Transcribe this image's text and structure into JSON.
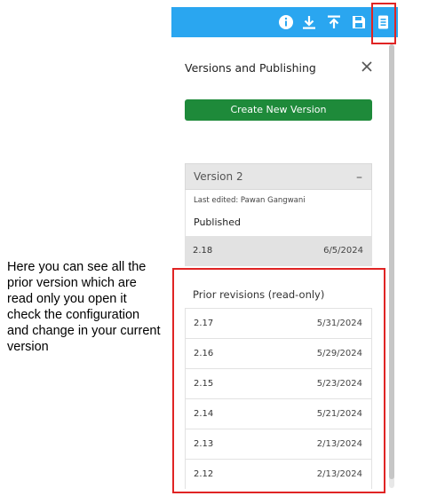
{
  "annotation": {
    "lines": [
      "Here you can see all the",
      "prior version which are",
      "read only you open it",
      "check the configuration",
      "and change in your current",
      "version"
    ]
  },
  "toolbar": {
    "icons": [
      "info-icon",
      "download-icon",
      "upload-icon",
      "save-icon",
      "document-icon"
    ],
    "background": "#2aa6f0"
  },
  "panel": {
    "title": "Versions and Publishing",
    "close_icon": "close-icon",
    "create_button_label": "Create New Version",
    "version": {
      "name": "Version 2",
      "collapse_symbol": "–",
      "last_edited": "Last edited: Pawan Gangwani",
      "status": "Published",
      "current": {
        "version": "2.18",
        "date": "6/5/2024"
      }
    },
    "prior_label": "Prior revisions (read-only)",
    "prior_revisions": [
      {
        "version": "2.17",
        "date": "5/31/2024"
      },
      {
        "version": "2.16",
        "date": "5/29/2024"
      },
      {
        "version": "2.15",
        "date": "5/23/2024"
      },
      {
        "version": "2.14",
        "date": "5/21/2024"
      },
      {
        "version": "2.13",
        "date": "2/13/2024"
      },
      {
        "version": "2.12",
        "date": "2/13/2024"
      }
    ]
  },
  "colors": {
    "primary_button": "#1e8a3a",
    "highlight": "#e02424"
  }
}
